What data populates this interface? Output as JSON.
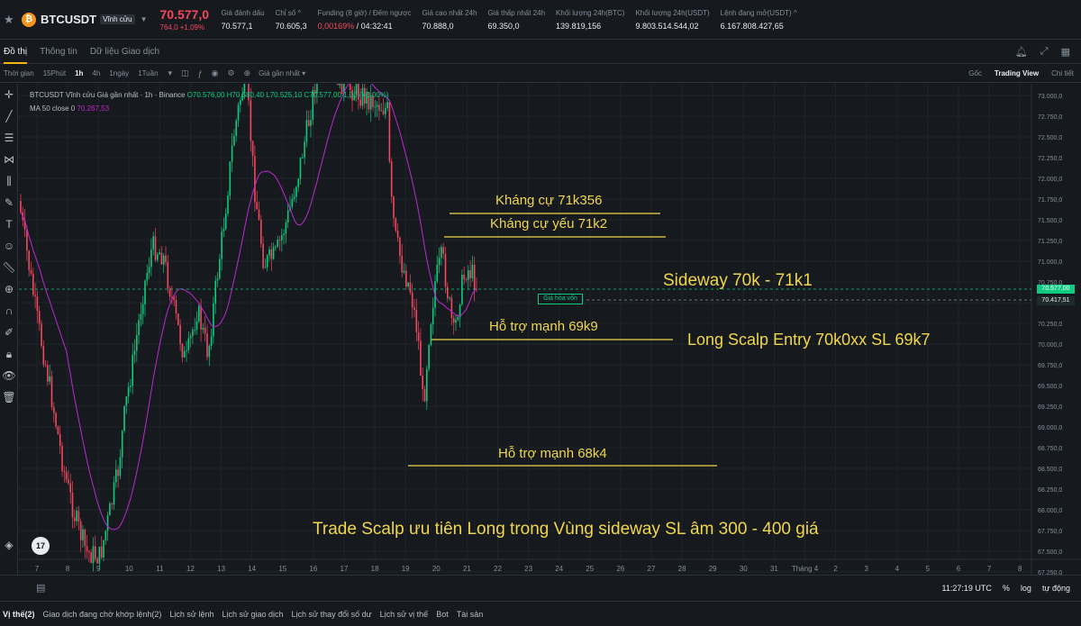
{
  "ticker": {
    "symbol": "BTCUSDT",
    "contract_type": "Vĩnh cửu",
    "price": "70.577,0",
    "change": "764,0 +1,09%",
    "stats": [
      {
        "label": "Giá đánh dấu",
        "value": "70.577,1"
      },
      {
        "label": "Chỉ số ^",
        "value": "70.605,3"
      },
      {
        "label": "Funding (8 giờ) / Đếm ngược",
        "value_neg": "0,00169%",
        "value": " / 04:32:41"
      },
      {
        "label": "Giá cao nhất 24h",
        "value": "70.888,0"
      },
      {
        "label": "Giá thấp nhất 24h",
        "value": "69.350,0"
      },
      {
        "label": "Khối lượng 24h(BTC)",
        "value": "139.819,156"
      },
      {
        "label": "Khối lượng 24h(USDT)",
        "value": "9.803.514.544,02"
      },
      {
        "label": "Lệnh đang mở(USDT) ^",
        "value": "6.167.808.427,65"
      }
    ]
  },
  "tabs": [
    "Đồ thị",
    "Thông tin",
    "Dữ liệu Giao dịch"
  ],
  "toolbar": {
    "items": [
      "Thời gian",
      "15Phút",
      "1h",
      "4h",
      "1ngày",
      "1Tuần"
    ],
    "price_type": "Giá gần nhất",
    "views": [
      "Gốc",
      "Trading View",
      "Chi tiết"
    ]
  },
  "chart": {
    "legend": "BTCUSDT Vĩnh cửu Giá gần nhất · 1h · Binance",
    "ohlc": "O70.576,00 H70.580,40 L70.525,10 C70.577,00 1,00 (+0,00%)",
    "ma_label": "MA 50 close 0",
    "ma_value": "70.267,53",
    "annotations": {
      "r1": "Kháng cự 71k356",
      "r2": "Kháng cự yếu 71k2",
      "sideway": "Sideway 70k - 71k1",
      "s1": "Hỗ trợ mạnh 69k9",
      "entry": "Long Scalp Entry 70k0xx SL 69k7",
      "s2": "Hỗ trợ mạnh 68k4",
      "trade": "Trade Scalp ưu tiên Long trong Vùng sideway SL âm 300 - 400 giá"
    },
    "breakeven_label": "Giá hòa vốn",
    "price_tag_last": "70.577,00",
    "price_tag_be": "70.417,51",
    "x_labels": [
      "7",
      "8",
      "9",
      "10",
      "11",
      "12",
      "13",
      "14",
      "15",
      "16",
      "17",
      "18",
      "19",
      "20",
      "21",
      "22",
      "23",
      "24",
      "25",
      "26",
      "27",
      "28",
      "29",
      "30",
      "31",
      "Tháng 4",
      "2",
      "3",
      "4",
      "5",
      "6",
      "7",
      "8"
    ],
    "y_labels": [
      "73.000,0",
      "72.750,0",
      "72.500,0",
      "72.250,0",
      "72.000,0",
      "71.750,0",
      "71.500,0",
      "71.250,0",
      "71.000,0",
      "70.750,0",
      "70.500,0",
      "70.250,0",
      "70.000,0",
      "69.750,0",
      "69.500,0",
      "69.250,0",
      "69.000,0",
      "68.750,0",
      "68.500,0",
      "68.250,0",
      "68.000,0",
      "67.750,0",
      "67.500,0",
      "67.250,0"
    ]
  },
  "chart_data": {
    "type": "line",
    "x": [
      "7",
      "8",
      "9",
      "10",
      "11",
      "12",
      "13",
      "14",
      "15",
      "16",
      "17",
      "18",
      "19",
      "20",
      "21"
    ],
    "series": [
      {
        "values": [
          67900,
          67200,
          67500,
          69000,
          70000,
          70200,
          72200,
          71200,
          71800,
          72800,
          72700,
          71200,
          69300,
          71100,
          70577
        ]
      }
    ],
    "ylim": [
      67000,
      73200
    ]
  },
  "footer": {
    "time": "11:27:19 UTC",
    "opts": [
      "%",
      "log",
      "tự động"
    ]
  },
  "positions": [
    "Vị thế(2)",
    "Giao dịch đang chờ khớp lệnh(2)",
    "Lịch sử lệnh",
    "Lịch sử giao dịch",
    "Lịch sử thay đổi số dư",
    "Lịch sử vị thế",
    "Bot",
    "Tài sản"
  ],
  "colors": {
    "up": "#0ecb81",
    "down": "#f6465d",
    "ma": "#c026d3",
    "annotation": "#f0d64c",
    "accent": "#f0b90b"
  }
}
